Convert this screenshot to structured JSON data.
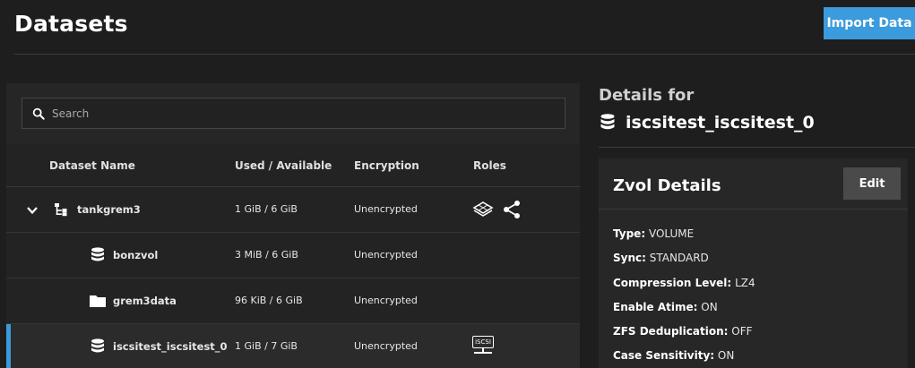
{
  "header": {
    "title": "Datasets",
    "import_label": "Import Data"
  },
  "search": {
    "placeholder": "Search",
    "value": ""
  },
  "table": {
    "columns": [
      "Dataset Name",
      "Used / Available",
      "Encryption",
      "Roles"
    ],
    "rows": [
      {
        "name": "tankgrem3",
        "usage": "1 GiB / 6 GiB",
        "encryption": "Unencrypted",
        "icon": "pool-tree-icon",
        "expanded": true,
        "roles": [
          "storage-role-icon",
          "share-icon"
        ]
      },
      {
        "name": "bonzvol",
        "usage": "3 MiB / 6 GiB",
        "encryption": "Unencrypted",
        "icon": "database-icon",
        "roles": []
      },
      {
        "name": "grem3data",
        "usage": "96 KiB / 6 GiB",
        "encryption": "Unencrypted",
        "icon": "folder-icon",
        "roles": []
      },
      {
        "name": "iscsitest_iscsitest_0",
        "usage": "1 GiB / 7 GiB",
        "encryption": "Unencrypted",
        "icon": "database-icon",
        "selected": true,
        "roles": [
          "iscsi-icon"
        ],
        "role_text": "iSCSI"
      }
    ]
  },
  "details": {
    "heading": "Details for",
    "name": "iscsitest_iscsitest_0",
    "card_title": "Zvol Details",
    "edit_label": "Edit",
    "properties": [
      {
        "key": "Type:",
        "value": "VOLUME"
      },
      {
        "key": "Sync:",
        "value": "STANDARD"
      },
      {
        "key": "Compression Level:",
        "value": "LZ4"
      },
      {
        "key": "Enable Atime:",
        "value": "ON"
      },
      {
        "key": "ZFS Deduplication:",
        "value": "OFF"
      },
      {
        "key": "Case Sensitivity:",
        "value": "ON"
      }
    ]
  },
  "colors": {
    "accent": "#3b9bdc",
    "background": "#1e1e1e",
    "panel": "#232323"
  }
}
